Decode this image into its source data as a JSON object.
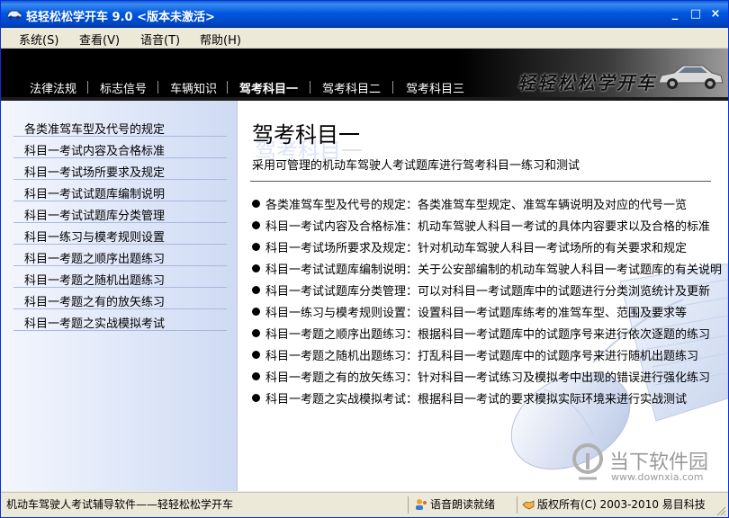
{
  "window": {
    "title": "轻轻松松学开车 9.0 <版本未激活>"
  },
  "menu": [
    {
      "label": "系统(S)"
    },
    {
      "label": "查看(V)"
    },
    {
      "label": "语音(T)"
    },
    {
      "label": "帮助(H)"
    }
  ],
  "header": {
    "logo_text": "轻轻松松学开车",
    "tabs": [
      {
        "label": "法律法规"
      },
      {
        "label": "标志信号"
      },
      {
        "label": "车辆知识"
      },
      {
        "label": "驾考科目一",
        "active": true
      },
      {
        "label": "驾考科目二"
      },
      {
        "label": "驾考科目三"
      }
    ]
  },
  "sidebar": {
    "items": [
      {
        "label": "各类准驾车型及代号的规定"
      },
      {
        "label": "科目一考试内容及合格标准"
      },
      {
        "label": "科目一考试场所要求及规定"
      },
      {
        "label": "科目一考试试题库编制说明"
      },
      {
        "label": "科目一考试试题库分类管理"
      },
      {
        "label": "科目一练习与模考规则设置"
      },
      {
        "label": "科目一考题之顺序出题练习"
      },
      {
        "label": "科目一考题之随机出题练习"
      },
      {
        "label": "科目一考题之有的放矢练习"
      },
      {
        "label": "科目一考题之实战模拟考试"
      }
    ]
  },
  "main": {
    "title": "驾考科目一",
    "subtitle": "采用可管理的机动车驾驶人考试题库进行驾考科目一练习和测试",
    "descriptions": [
      {
        "text": "各类准驾车型及代号的规定：各类准驾车型规定、准驾车辆说明及对应的代号一览"
      },
      {
        "text": "科目一考试内容及合格标准：机动车驾驶人科目一考试的具体内容要求以及合格的标准"
      },
      {
        "text": "科目一考试场所要求及规定：针对机动车驾驶人科目一考试场所的有关要求和规定"
      },
      {
        "text": "科目一考试试题库编制说明：关于公安部编制的机动车驾驶人科目一考试题库的有关说明"
      },
      {
        "text": "科目一考试试题库分类管理：可以对科目一考试题库中的试题进行分类浏览统计及更新"
      },
      {
        "text": "科目一练习与模考规则设置：设置科目一考试题库练考的准驾车型、范围及要求等"
      },
      {
        "text": "科目一考题之顺序出题练习：根据科目一考试题库中的试题序号来进行依次逐题的练习"
      },
      {
        "text": "科目一考题之随机出题练习：打乱科目一考试题库中的试题序号来进行随机出题练习"
      },
      {
        "text": "科目一考题之有的放矢练习：针对科目一考试练习及模拟考中出现的错误进行强化练习"
      },
      {
        "text": "科目一考题之实战模拟考试：根据科目一考试的要求模拟实际环境来进行实战测试"
      }
    ],
    "watermark": {
      "text": "当下软件园",
      "url": "www.downxia.com"
    }
  },
  "status": {
    "left": "机动车驾驶人考试辅导软件——轻轻松松学开车",
    "voice": "语音朗读就绪",
    "copyright": "版权所有(C) 2003-2010 易目科技"
  },
  "colors": {
    "titlebar": "#0058e0",
    "header_bg": "#000000",
    "sidebar_bg": "#dde6f8",
    "chrome": "#ece9d8"
  }
}
